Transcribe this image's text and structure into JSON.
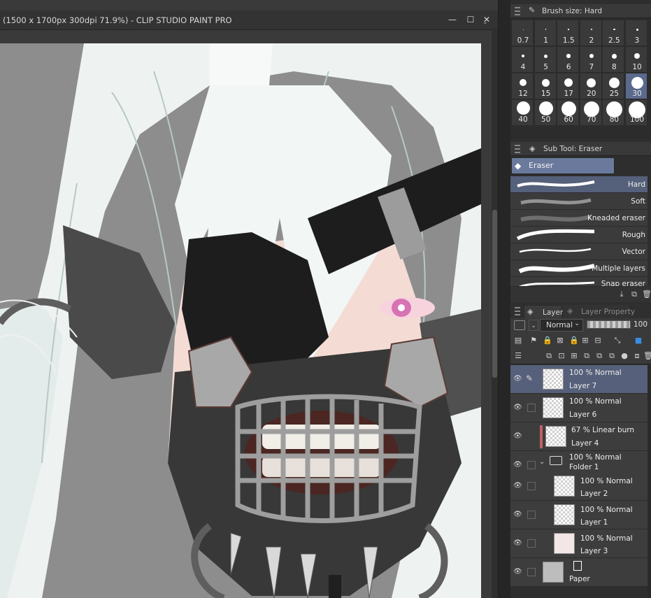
{
  "window": {
    "title": "(1500 x 1700px 300dpi 71.9%)  - CLIP STUDIO PAINT PRO",
    "minimize": "—",
    "maximize": "☐",
    "close": "✕"
  },
  "brush_size_panel": {
    "title": "Brush size: Hard",
    "sizes": [
      "0.7",
      "1",
      "1.5",
      "2",
      "2.5",
      "3",
      "4",
      "5",
      "6",
      "7",
      "8",
      "10",
      "12",
      "15",
      "17",
      "20",
      "25",
      "30",
      "40",
      "50",
      "60",
      "70",
      "80",
      "100"
    ],
    "selected": "30"
  },
  "sub_tool_panel": {
    "title": "Sub Tool: Eraser",
    "group": "Eraser",
    "items": [
      "Hard",
      "Soft",
      "Kneaded eraser",
      "Rough",
      "Vector",
      "Multiple layers",
      "Snap eraser"
    ],
    "selected": "Hard"
  },
  "layer_panel": {
    "tab_layer": "Layer",
    "tab_layer_property": "Layer Property",
    "blend_mode": "Normal",
    "opacity": "100",
    "layers": [
      {
        "mode": "100 % Normal",
        "name": "Layer 7",
        "selected": true
      },
      {
        "mode": "100 % Normal",
        "name": "Layer 6"
      },
      {
        "mode": "67 % Linear burn",
        "name": "Layer 4"
      },
      {
        "mode": "100 % Normal",
        "name": "Folder 1",
        "folder": true
      },
      {
        "mode": "100 % Normal",
        "name": "Layer 2"
      },
      {
        "mode": "100 % Normal",
        "name": "Layer 1"
      },
      {
        "mode": "100 % Normal",
        "name": "Layer 3"
      },
      {
        "mode": "",
        "name": "Paper"
      }
    ]
  },
  "colors": {
    "selection": "#56607a",
    "panel": "#3d3d3d",
    "accent_clip": "#c06060"
  }
}
